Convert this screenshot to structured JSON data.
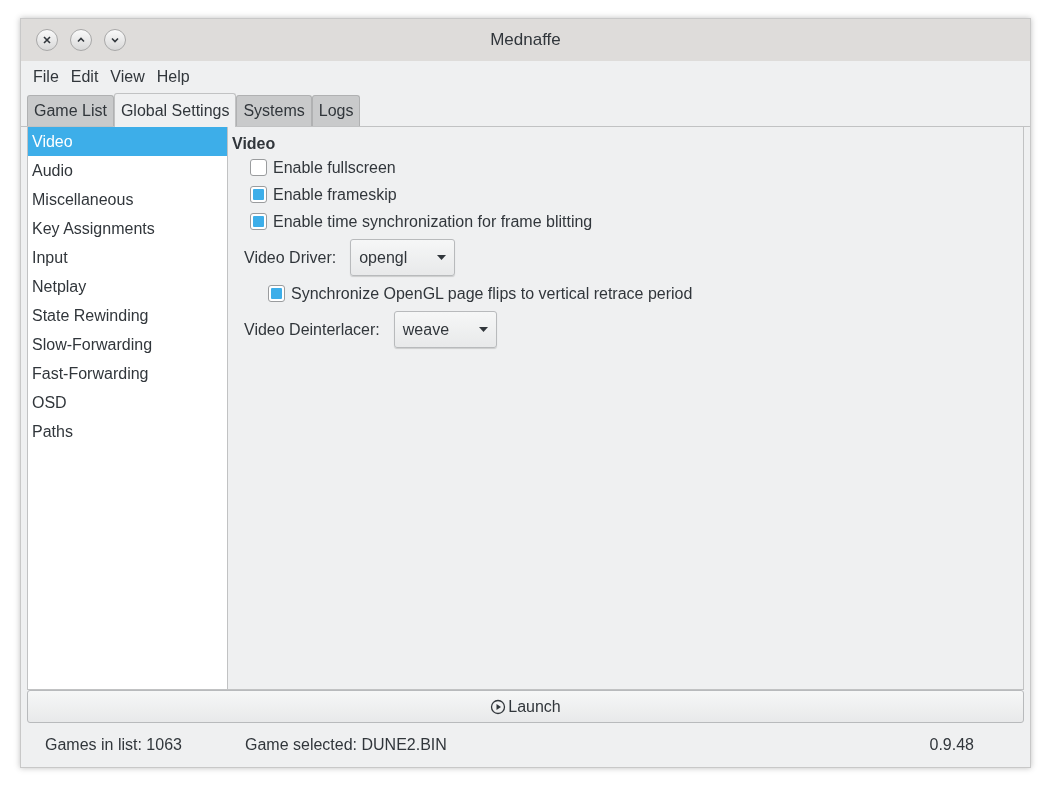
{
  "window": {
    "title": "Mednaffe"
  },
  "menu": [
    "File",
    "Edit",
    "View",
    "Help"
  ],
  "tabs": [
    {
      "label": "Game List",
      "selected": false
    },
    {
      "label": "Global Settings",
      "selected": true
    },
    {
      "label": "Systems",
      "selected": false
    },
    {
      "label": "Logs",
      "selected": false
    }
  ],
  "sidebar": {
    "items": [
      {
        "label": "Video",
        "selected": true
      },
      {
        "label": "Audio",
        "selected": false
      },
      {
        "label": "Miscellaneous",
        "selected": false
      },
      {
        "label": "Key Assignments",
        "selected": false
      },
      {
        "label": "Input",
        "selected": false
      },
      {
        "label": "Netplay",
        "selected": false
      },
      {
        "label": "State Rewinding",
        "selected": false
      },
      {
        "label": "Slow-Forwarding",
        "selected": false
      },
      {
        "label": "Fast-Forwarding",
        "selected": false
      },
      {
        "label": "OSD",
        "selected": false
      },
      {
        "label": "Paths",
        "selected": false
      }
    ]
  },
  "section": {
    "title": "Video",
    "settings": [
      {
        "kind": "checkbox",
        "label": "Enable fullscreen",
        "checked": false
      },
      {
        "kind": "checkbox",
        "label": "Enable frameskip",
        "checked": true
      },
      {
        "kind": "checkbox",
        "label": "Enable time synchronization for frame blitting",
        "checked": true
      },
      {
        "kind": "dropdown",
        "label": "Video Driver:",
        "value": "opengl",
        "children": [
          {
            "kind": "checkbox",
            "label": "Synchronize OpenGL page flips to vertical retrace period",
            "checked": true
          }
        ]
      },
      {
        "kind": "dropdown",
        "label": "Video Deinterlacer:",
        "value": "weave"
      }
    ]
  },
  "launch_button": {
    "label": "Launch"
  },
  "status_bar": {
    "games_in_list": "Games in list: 1063",
    "game_selected": "Game selected: DUNE2.BIN",
    "version": "0.9.48"
  }
}
